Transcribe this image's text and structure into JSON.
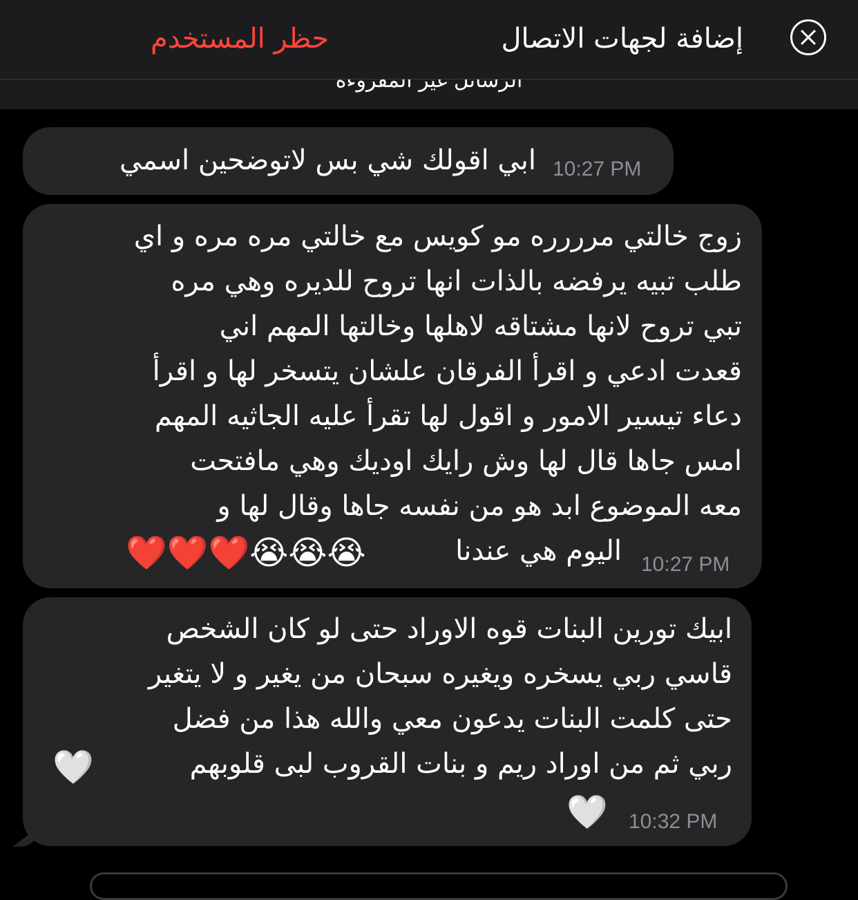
{
  "header": {
    "close_icon": "close-circle-icon",
    "add_contact_label": "إضافة لجهات الاتصال",
    "block_user_label": "حظر المستخدم",
    "block_color": "#ff453a"
  },
  "unread_divider": {
    "label": "الرسائل غير المقروءة"
  },
  "messages": [
    {
      "text": "ابي اقولك شي بس لاتوضحين اسمي",
      "time": "10:27 PM"
    },
    {
      "text": "زوج خالتي مرررره مو كويس مع خالتي مره مره و اي\nطلب تبيه يرفضه بالذات انها تروح للديره وهي مره\nتبي تروح لانها مشتاقه لاهلها وخالتها المهم اني\nقعدت ادعي و اقرأ الفرقان علشان يتسخر لها و اقرأ\nدعاء تيسير الامور و اقول لها تقرأ عليه الجاثيه المهم\nامس جاها قال لها وش رايك اوديك وهي مافتحت\nمعه الموضوع ابد هو من نفسه جاها وقال لها و",
      "last_line": "اليوم هي عندنا",
      "emojis": "❤️❤️❤️😭😭😭",
      "time": "10:27 PM"
    },
    {
      "text": "ابيك تورين البنات قوه الاوراد حتى لو كان الشخص\nقاسي ربي يسخره ويغيره سبحان من يغير و لا يتغير\nحتى كلمت البنات يدعون معي والله هذا من فضل\nربي ثم من اوراد ريم و بنات القروب لبى قلوبهم",
      "emoji_line_end": "🤍",
      "emoji_last": "🤍",
      "time": "10:32 PM"
    }
  ]
}
